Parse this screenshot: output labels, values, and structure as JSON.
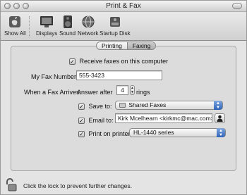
{
  "window": {
    "title": "Print & Fax"
  },
  "toolbar": {
    "items": [
      {
        "label": "Show All",
        "icon": "show-all-icon"
      },
      {
        "label": "Displays",
        "icon": "display-icon"
      },
      {
        "label": "Sound",
        "icon": "speaker-icon"
      },
      {
        "label": "Network",
        "icon": "network-globe-icon"
      },
      {
        "label": "Startup Disk",
        "icon": "disk-icon"
      }
    ]
  },
  "tabs": {
    "printing": "Printing",
    "faxing": "Faxing",
    "selected": "Faxing"
  },
  "fax": {
    "receive_label": "Receive faxes on this computer",
    "receive_checked": true,
    "number_label": "My Fax Number:",
    "number_value": "555-3423",
    "arrive_label": "When a Fax Arrives:",
    "answer_prefix": "Answer after",
    "rings_value": "4",
    "rings_suffix": "rings",
    "save_label": "Save to:",
    "save_checked": true,
    "save_value": "Shared Faxes",
    "email_label": "Email to:",
    "email_checked": true,
    "email_value": "Kirk Mcelhearn <kirkmc@mac.com>",
    "print_label": "Print on printer:",
    "print_checked": true,
    "print_value": "HL-1440 series"
  },
  "lock": {
    "text": "Click the lock to prevent further changes.",
    "state": "unlocked"
  }
}
